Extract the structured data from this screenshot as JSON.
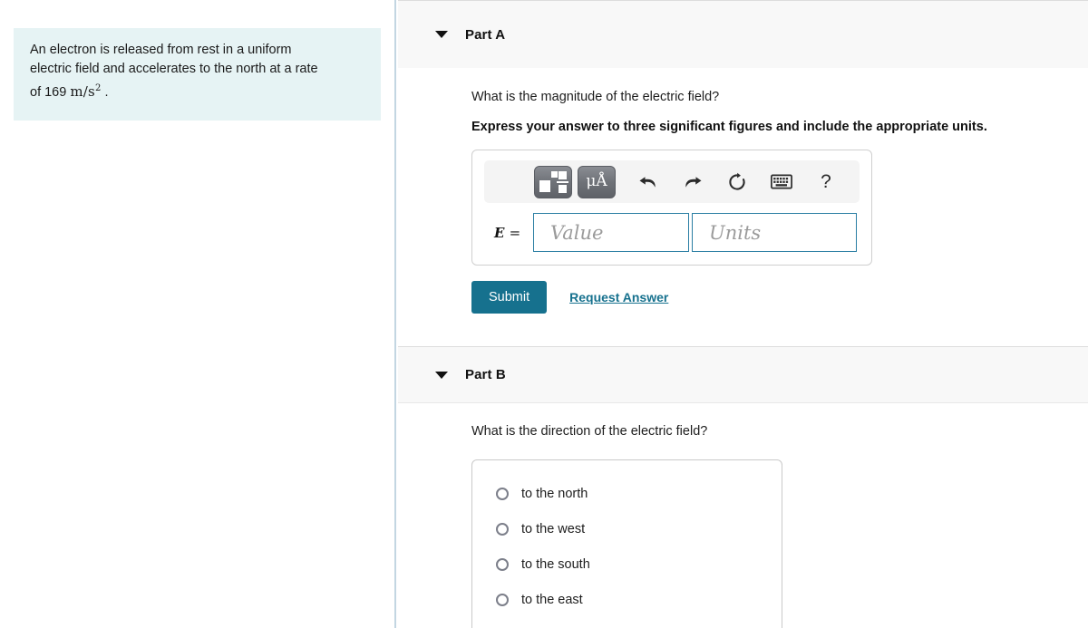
{
  "problem": {
    "line1": "An electron is released from rest in a uniform",
    "line2": "electric field and accelerates to the north at a rate",
    "line3_prefix": "of 169",
    "math_unit": "m/s",
    "math_exponent": "2",
    "line3_suffix": "."
  },
  "partA": {
    "label": "Part A",
    "question": "What is the magnitude of the electric field?",
    "instruction": "Express your answer to three significant figures and include the appropriate units.",
    "toolbar": {
      "template_icon": "math-template-icon",
      "units_icon_text": "μÅ",
      "undo_icon": "undo-arrow-icon",
      "redo_icon": "redo-arrow-icon",
      "reset_icon": "reset-circular-arrow-icon",
      "keyboard_icon": "keyboard-icon",
      "help_icon": "?"
    },
    "variable": "E",
    "equals": "=",
    "value_placeholder": "Value",
    "units_placeholder": "Units",
    "submit_label": "Submit",
    "request_answer_label": "Request Answer"
  },
  "partB": {
    "label": "Part B",
    "question": "What is the direction of the electric field?",
    "choices": [
      "to the north",
      "to the west",
      "to the south",
      "to the east"
    ],
    "selected": null
  },
  "colors": {
    "problem_bg": "#e6f3f4",
    "band_bg": "#f8f8f8",
    "accent_teal": "#16718e",
    "field_border": "#2a7ea3",
    "divider": "#c3d6e2"
  }
}
